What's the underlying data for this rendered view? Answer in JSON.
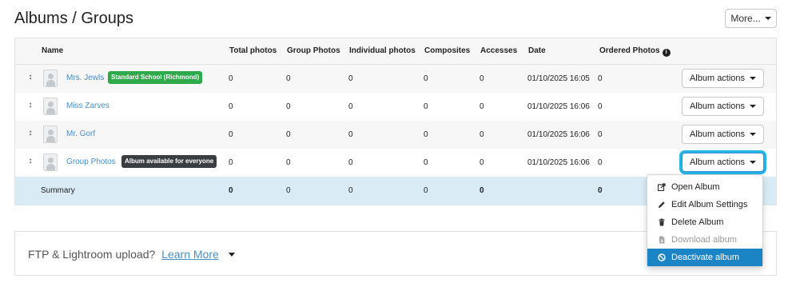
{
  "page": {
    "title": "Albums / Groups",
    "more_label": "More..."
  },
  "table": {
    "headers": {
      "name": "Name",
      "total_photos": "Total photos",
      "group_photos": "Group Photos",
      "individual_photos": "Individual photos",
      "composites": "Composites",
      "accesses": "Accesses",
      "date": "Date",
      "ordered_photos": "Ordered Photos"
    },
    "rows": [
      {
        "name": "Mrs. Jewls",
        "badge": "Standard School (Richmond)",
        "total": "0",
        "group": "0",
        "individual": "0",
        "composites": "0",
        "accesses": "0",
        "date": "01/10/2025 16:05",
        "ordered": "0",
        "action": "Album actions"
      },
      {
        "name": "Miss Zarves",
        "badge": "",
        "total": "0",
        "group": "0",
        "individual": "0",
        "composites": "0",
        "accesses": "0",
        "date": "01/10/2025 16:06",
        "ordered": "0",
        "action": "Album actions"
      },
      {
        "name": "Mr. Gorf",
        "badge": "",
        "total": "0",
        "group": "0",
        "individual": "0",
        "composites": "0",
        "accesses": "0",
        "date": "01/10/2025 16:06",
        "ordered": "0",
        "action": "Album actions"
      },
      {
        "name": "Group Photos",
        "badge": "Album available for everyone",
        "total": "0",
        "group": "0",
        "individual": "0",
        "composites": "0",
        "accesses": "0",
        "date": "01/10/2025 16:06",
        "ordered": "0",
        "action": "Album actions"
      }
    ],
    "summary": {
      "label": "Summary",
      "total": "0",
      "group": "0",
      "individual": "0",
      "composites": "0",
      "accesses": "0",
      "ordered": "0"
    }
  },
  "dropdown": {
    "items": [
      {
        "label": "Open Album",
        "icon": "share-icon",
        "state": "normal"
      },
      {
        "label": "Edit Album Settings",
        "icon": "pencil-icon",
        "state": "normal"
      },
      {
        "label": "Delete Album",
        "icon": "trash-icon",
        "state": "normal"
      },
      {
        "label": "Download album",
        "icon": "file-download-icon",
        "state": "disabled"
      },
      {
        "label": "Deactivate album",
        "icon": "ban-icon",
        "state": "highlighted"
      }
    ]
  },
  "ftp": {
    "text": "FTP & Lightroom upload?",
    "link": "Learn More"
  },
  "colors": {
    "link": "#4a8fc7",
    "badge_green": "#2eaa4a",
    "badge_dark": "#3a3d42",
    "summary_bg": "#d9ecf5",
    "focus_ring": "#22b5e6",
    "menu_highlight": "#1b84c4"
  }
}
